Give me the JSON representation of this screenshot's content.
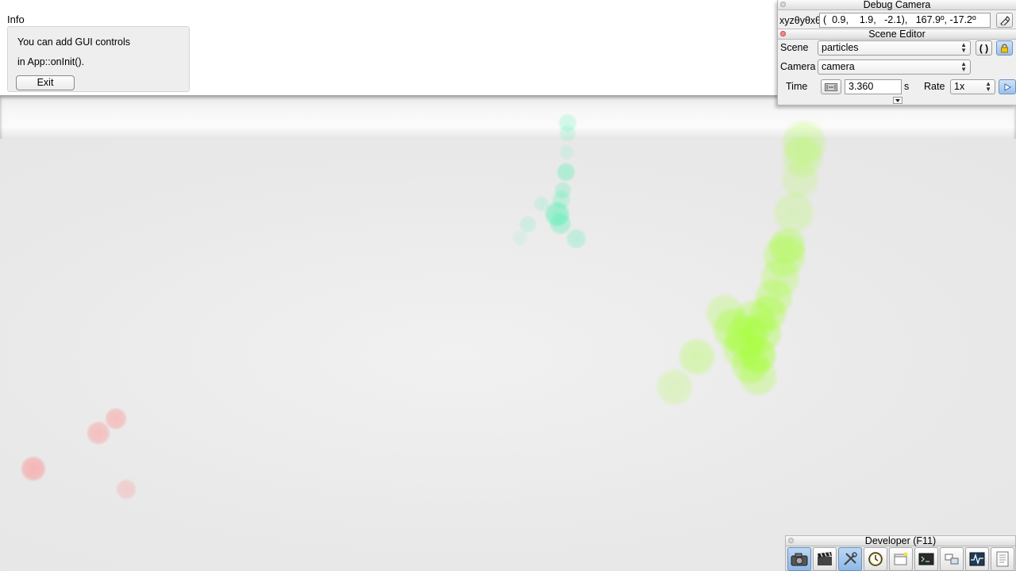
{
  "info": {
    "title": "Info",
    "line1": "You can add GUI controls",
    "line2": "in App::onInit().",
    "exit_label": "Exit"
  },
  "debug_camera": {
    "title": "Debug Camera",
    "xyz_label": "xyzθyθxθz",
    "value": "(  0.9,    1.9,   -2.1),   167.9º, -17.2º"
  },
  "scene_editor": {
    "title": "Scene Editor",
    "scene_label": "Scene",
    "scene_value": "particles",
    "camera_label": "Camera",
    "camera_value": "camera",
    "time_label": "Time",
    "time_value": "3.360",
    "time_unit": "s",
    "rate_label": "Rate",
    "rate_value": "1x"
  },
  "developer": {
    "title": "Developer (F11)",
    "tools": [
      "camera-icon",
      "clapperboard-icon",
      "tools-icon",
      "clock-icon",
      "window-icon",
      "terminal-icon",
      "scene-graph-icon",
      "profiler-icon",
      "log-icon"
    ]
  },
  "colors": {
    "green_particles": "#a6ff3a",
    "teal_particles": "#4ef0b0",
    "red_particles": "#ff8a8a",
    "active_tool": "#9fc4ec"
  }
}
